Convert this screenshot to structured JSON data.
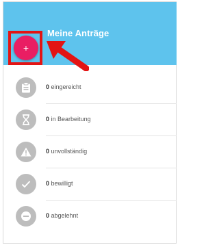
{
  "header": {
    "title": "Meine Anträge"
  },
  "fab": {
    "label": "+",
    "icon": "plus-icon",
    "color": "#e91e63"
  },
  "annotation": {
    "box_color": "#e31414",
    "arrow_color": "#e31414"
  },
  "theme": {
    "header_bg": "#5ec3ed",
    "icon_bg": "#bdbdbd"
  },
  "status_list": [
    {
      "count": "0",
      "label": "eingereicht",
      "icon": "clipboard-icon"
    },
    {
      "count": "0",
      "label": "in Bearbeitung",
      "icon": "hourglass-icon"
    },
    {
      "count": "0",
      "label": "unvollständig",
      "icon": "warning-icon"
    },
    {
      "count": "0",
      "label": "bewilligt",
      "icon": "check-icon"
    },
    {
      "count": "0",
      "label": "abgelehnt",
      "icon": "minus-circle-icon"
    }
  ]
}
